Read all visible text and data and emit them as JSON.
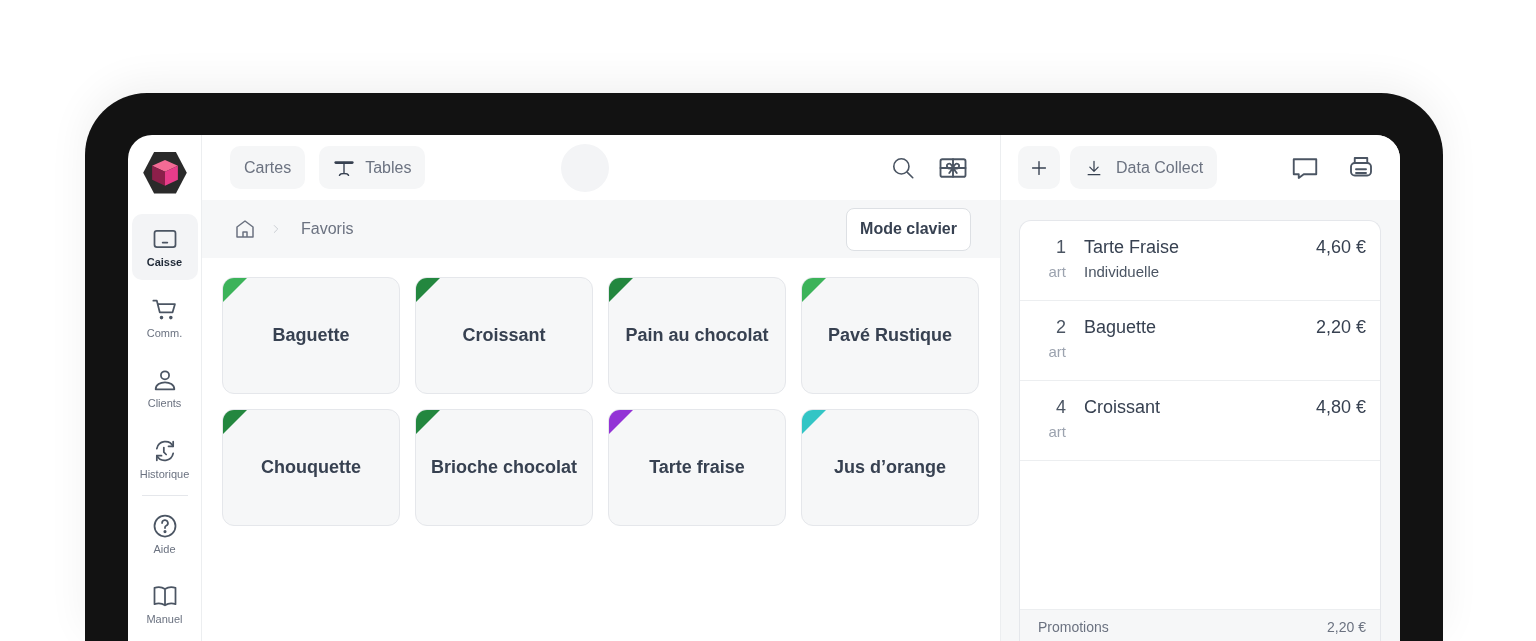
{
  "sidebar": {
    "main_items": [
      {
        "label": "Caisse",
        "selected": true
      },
      {
        "label": "Comm.",
        "selected": false
      },
      {
        "label": "Clients",
        "selected": false
      },
      {
        "label": "Historique",
        "selected": false
      }
    ],
    "help_items": [
      {
        "label": "Aide",
        "selected": false
      },
      {
        "label": "Manuel",
        "selected": false
      }
    ]
  },
  "top_bar": {
    "buttons": [
      "Cartes",
      "Tables"
    ]
  },
  "breadcrumb": {
    "path": [
      "Favoris"
    ],
    "mode_button": "Mode clavier"
  },
  "tiles": [
    {
      "label": "Baguette",
      "color": "#3cb35a"
    },
    {
      "label": "Croissant",
      "color": "#23873f"
    },
    {
      "label": "Pain au chocolat",
      "color": "#23873f"
    },
    {
      "label": "Pavé Rustique",
      "color": "#3cb35a"
    },
    {
      "label": "Chouquette",
      "color": "#23873f"
    },
    {
      "label": "Brioche chocolat",
      "color": "#23873f"
    },
    {
      "label": "Tarte fraise",
      "color": "#9333d6"
    },
    {
      "label": "Jus d’orange",
      "color": "#33c5c5"
    }
  ],
  "ticket": {
    "toolbar_button": "Data Collect",
    "lines": [
      {
        "qty": "1",
        "name": "Tarte Fraise",
        "unit": "art",
        "note": "Individuelle",
        "price": "4,60 €"
      },
      {
        "qty": "2",
        "name": "Baguette",
        "unit": "art",
        "price": "2,20 €"
      },
      {
        "qty": "4",
        "name": "Croissant",
        "unit": "art",
        "price": "4,80 €"
      }
    ],
    "summary": {
      "label": "Promotions",
      "value": "2,20 €"
    }
  }
}
